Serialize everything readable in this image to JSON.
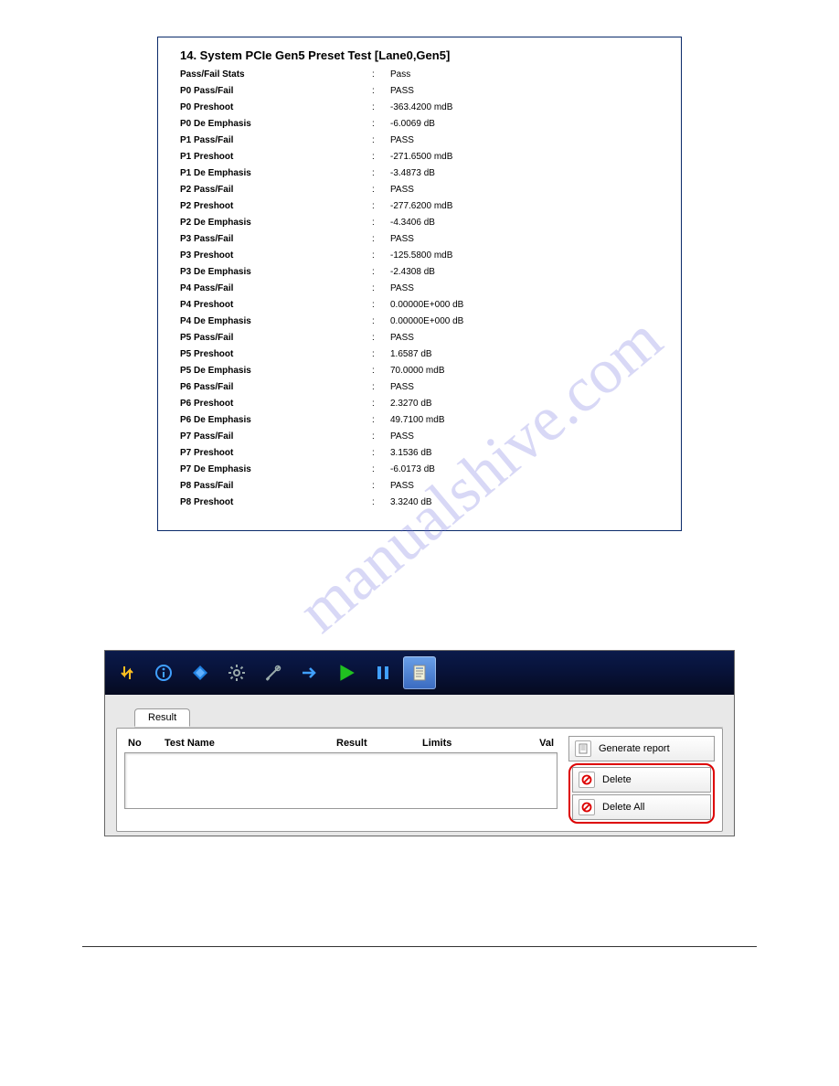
{
  "watermark": "manualshive.com",
  "report": {
    "title": "14. System PCIe Gen5 Preset Test [Lane0,Gen5]",
    "rows": [
      {
        "label": "Pass/Fail Stats",
        "value": "Pass"
      },
      {
        "label": "P0 Pass/Fail",
        "value": "PASS"
      },
      {
        "label": "P0 Preshoot",
        "value": "-363.4200 mdB"
      },
      {
        "label": "P0 De Emphasis",
        "value": "-6.0069 dB"
      },
      {
        "label": "P1 Pass/Fail",
        "value": "PASS"
      },
      {
        "label": "P1 Preshoot",
        "value": "-271.6500 mdB"
      },
      {
        "label": "P1 De Emphasis",
        "value": "-3.4873 dB"
      },
      {
        "label": "P2 Pass/Fail",
        "value": "PASS"
      },
      {
        "label": "P2 Preshoot",
        "value": "-277.6200 mdB"
      },
      {
        "label": "P2 De Emphasis",
        "value": "-4.3406 dB"
      },
      {
        "label": "P3 Pass/Fail",
        "value": "PASS"
      },
      {
        "label": "P3 Preshoot",
        "value": "-125.5800 mdB"
      },
      {
        "label": "P3 De Emphasis",
        "value": "-2.4308 dB"
      },
      {
        "label": "P4 Pass/Fail",
        "value": "PASS"
      },
      {
        "label": "P4 Preshoot",
        "value": "0.00000E+000 dB"
      },
      {
        "label": "P4 De Emphasis",
        "value": "0.00000E+000 dB"
      },
      {
        "label": "P5 Pass/Fail",
        "value": "PASS"
      },
      {
        "label": "P5 Preshoot",
        "value": "1.6587 dB"
      },
      {
        "label": "P5 De Emphasis",
        "value": "70.0000 mdB"
      },
      {
        "label": "P6 Pass/Fail",
        "value": "PASS"
      },
      {
        "label": "P6 Preshoot",
        "value": "2.3270 dB"
      },
      {
        "label": "P6 De Emphasis",
        "value": "49.7100 mdB"
      },
      {
        "label": "P7 Pass/Fail",
        "value": "PASS"
      },
      {
        "label": "P7 Preshoot",
        "value": "3.1536 dB"
      },
      {
        "label": "P7 De Emphasis",
        "value": "-6.0173 dB"
      },
      {
        "label": "P8 Pass/Fail",
        "value": "PASS"
      },
      {
        "label": "P8 Preshoot",
        "value": "3.3240 dB"
      }
    ]
  },
  "toolbar": {
    "icons": [
      "updown-arrow-icon",
      "info-icon",
      "diamond-icon",
      "gear-icon",
      "tools-icon",
      "arrow-right-icon",
      "play-icon",
      "pause-icon",
      "document-icon"
    ]
  },
  "resultPanel": {
    "tab": "Result",
    "columns": {
      "no": "No",
      "test": "Test Name",
      "result": "Result",
      "limits": "Limits",
      "val": "Val"
    },
    "rows": []
  },
  "actions": {
    "generate": "Generate report",
    "delete": "Delete",
    "deleteAll": "Delete All"
  }
}
